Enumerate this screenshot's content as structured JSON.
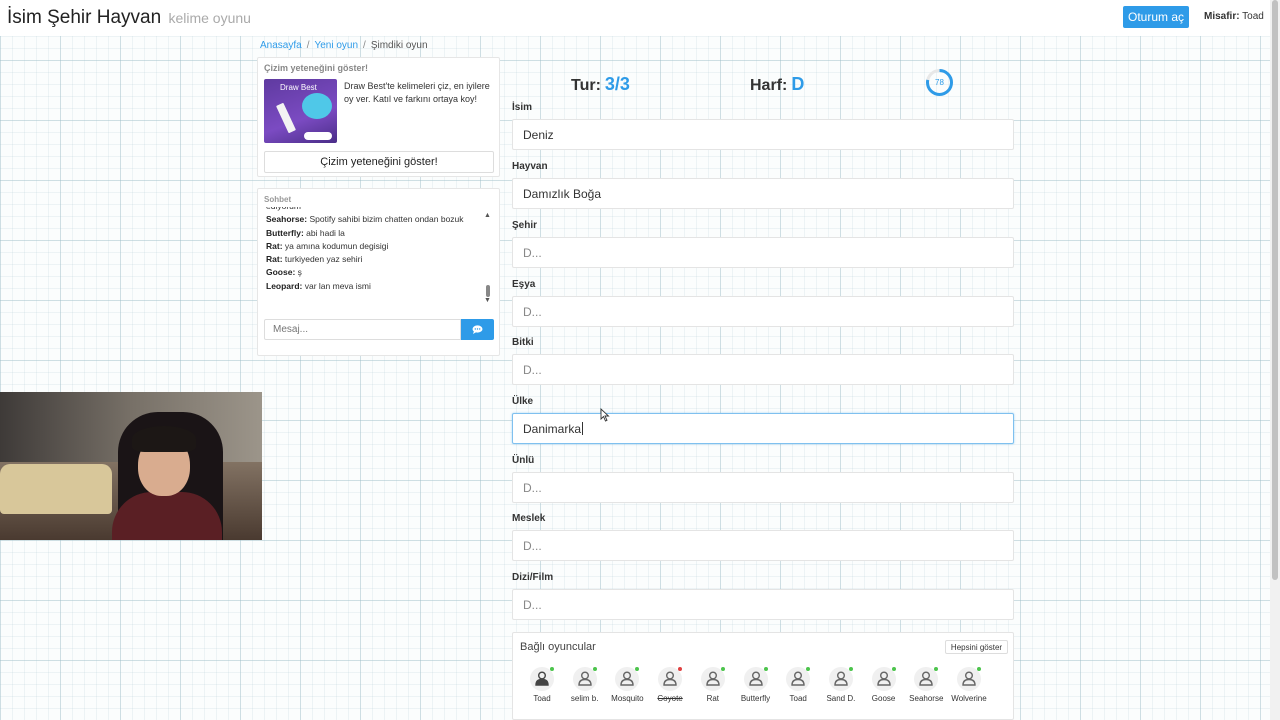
{
  "header": {
    "title": "İsim Şehir Hayvan",
    "subtitle": "kelime oyunu",
    "login_label": "Oturum aç",
    "guest_label": "Misafir:",
    "guest_name": "Toad"
  },
  "breadcrumb": [
    "Anasayfa",
    "Yeni oyun",
    "Şimdiki oyun"
  ],
  "ad": {
    "title": "Çizim yeteneğini göster!",
    "image_text": "Draw Best",
    "text": "Draw Best'te kelimeleri çiz, en iyilere oy ver. Katıl ve farkını ortaya koy!",
    "button_label": "Çizim yeteneğini göster!"
  },
  "chat": {
    "title": "Sohbet",
    "partial_line": "ediyorum",
    "messages": [
      {
        "user": "Seahorse:",
        "text": "Spotify sahibi bizim chatten ondan bozuk"
      },
      {
        "user": "Butterfly:",
        "text": "abi hadi la"
      },
      {
        "user": "Rat:",
        "text": "ya amına kodumun degisigi"
      },
      {
        "user": "Rat:",
        "text": "turkiyeden yaz sehiri"
      },
      {
        "user": "Goose:",
        "text": "ş"
      },
      {
        "user": "Leopard:",
        "text": "var lan meva ismi"
      }
    ],
    "input_placeholder": "Mesaj..."
  },
  "game": {
    "round_label": "Tur:",
    "round_value": "3/3",
    "letter_label": "Harf:",
    "letter_value": "D",
    "timer_value": "78",
    "timer_fraction": 0.78
  },
  "fields": [
    {
      "label": "İsim",
      "value": "Deniz",
      "placeholder": false
    },
    {
      "label": "Hayvan",
      "value": "Damızlık Boğa",
      "placeholder": false
    },
    {
      "label": "Şehir",
      "value": "D...",
      "placeholder": true
    },
    {
      "label": "Eşya",
      "value": "D...",
      "placeholder": true
    },
    {
      "label": "Bitki",
      "value": "D...",
      "placeholder": true
    },
    {
      "label": "Ülke",
      "value": "Danimarka",
      "placeholder": false
    },
    {
      "label": "Ünlü",
      "value": "D...",
      "placeholder": true
    },
    {
      "label": "Meslek",
      "value": "D...",
      "placeholder": true
    },
    {
      "label": "Dizi/Film",
      "value": "D...",
      "placeholder": true
    }
  ],
  "players": {
    "title": "Bağlı oyuncular",
    "show_all_label": "Hepsini göster",
    "list": [
      {
        "name": "Toad",
        "online": true,
        "strike": false
      },
      {
        "name": "selim b.",
        "online": true,
        "strike": false
      },
      {
        "name": "Mosquito",
        "online": true,
        "strike": false
      },
      {
        "name": "Coyote",
        "online": false,
        "strike": true
      },
      {
        "name": "Rat",
        "online": true,
        "strike": false
      },
      {
        "name": "Butterfly",
        "online": true,
        "strike": false
      },
      {
        "name": "Toad",
        "online": true,
        "strike": false
      },
      {
        "name": "Sand D.",
        "online": true,
        "strike": false
      },
      {
        "name": "Goose",
        "online": true,
        "strike": false
      },
      {
        "name": "Seahorse",
        "online": true,
        "strike": false
      },
      {
        "name": "Wolverine",
        "online": true,
        "strike": false
      }
    ]
  },
  "colors": {
    "accent": "#2e9be8",
    "online": "#4cc44c",
    "offline": "#e04040"
  }
}
